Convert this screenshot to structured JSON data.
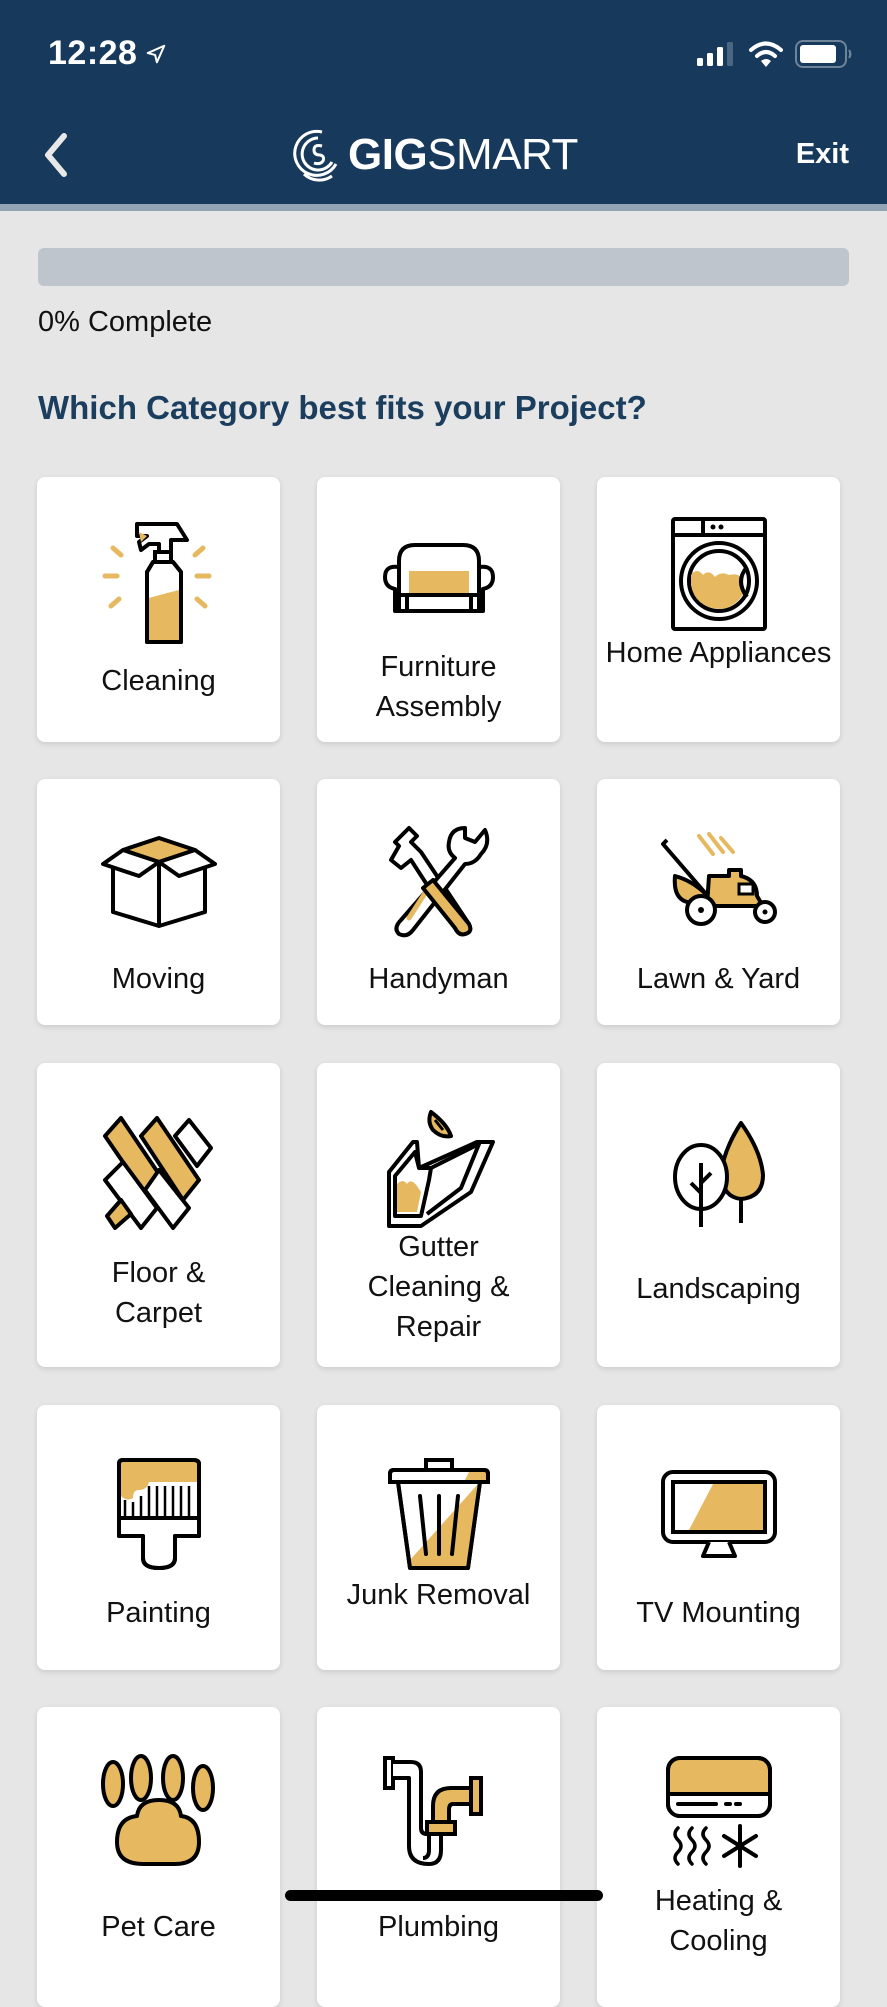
{
  "status_bar": {
    "time": "12:28",
    "location_icon": "location-arrow-icon",
    "signal_icon": "cellular-signal-icon",
    "wifi_icon": "wifi-icon",
    "battery_icon": "battery-icon"
  },
  "nav": {
    "back_icon": "chevron-left-icon",
    "logo_bold": "GIG",
    "logo_regular": "SMART",
    "exit_label": "Exit"
  },
  "progress": {
    "percent": 0,
    "label": "0% Complete"
  },
  "question": "Which Category best fits your Project?",
  "colors": {
    "header": "#17395b",
    "accent": "#e6b960",
    "heading": "#1b3d5e",
    "progress_track": "#bec5cd"
  },
  "categories": [
    {
      "label": "Cleaning",
      "icon": "spray-bottle-icon"
    },
    {
      "label": "Furniture Assembly",
      "icon": "armchair-icon"
    },
    {
      "label": "Home Appliances",
      "icon": "washing-machine-icon"
    },
    {
      "label": "Moving",
      "icon": "open-box-icon"
    },
    {
      "label": "Handyman",
      "icon": "hammer-wrench-icon"
    },
    {
      "label": "Lawn & Yard",
      "icon": "lawn-mower-icon"
    },
    {
      "label": "Floor & Carpet",
      "icon": "floor-planks-icon"
    },
    {
      "label": "Gutter Cleaning & Repair",
      "icon": "gutter-leaf-icon"
    },
    {
      "label": "Landscaping",
      "icon": "trees-icon"
    },
    {
      "label": "Painting",
      "icon": "paint-brush-icon"
    },
    {
      "label": "Junk Removal",
      "icon": "trash-can-icon"
    },
    {
      "label": "TV Mounting",
      "icon": "tv-monitor-icon"
    },
    {
      "label": "Pet Care",
      "icon": "paw-print-icon"
    },
    {
      "label": "Plumbing",
      "icon": "pipe-icon"
    },
    {
      "label": "Heating & Cooling",
      "icon": "air-conditioner-icon"
    }
  ]
}
